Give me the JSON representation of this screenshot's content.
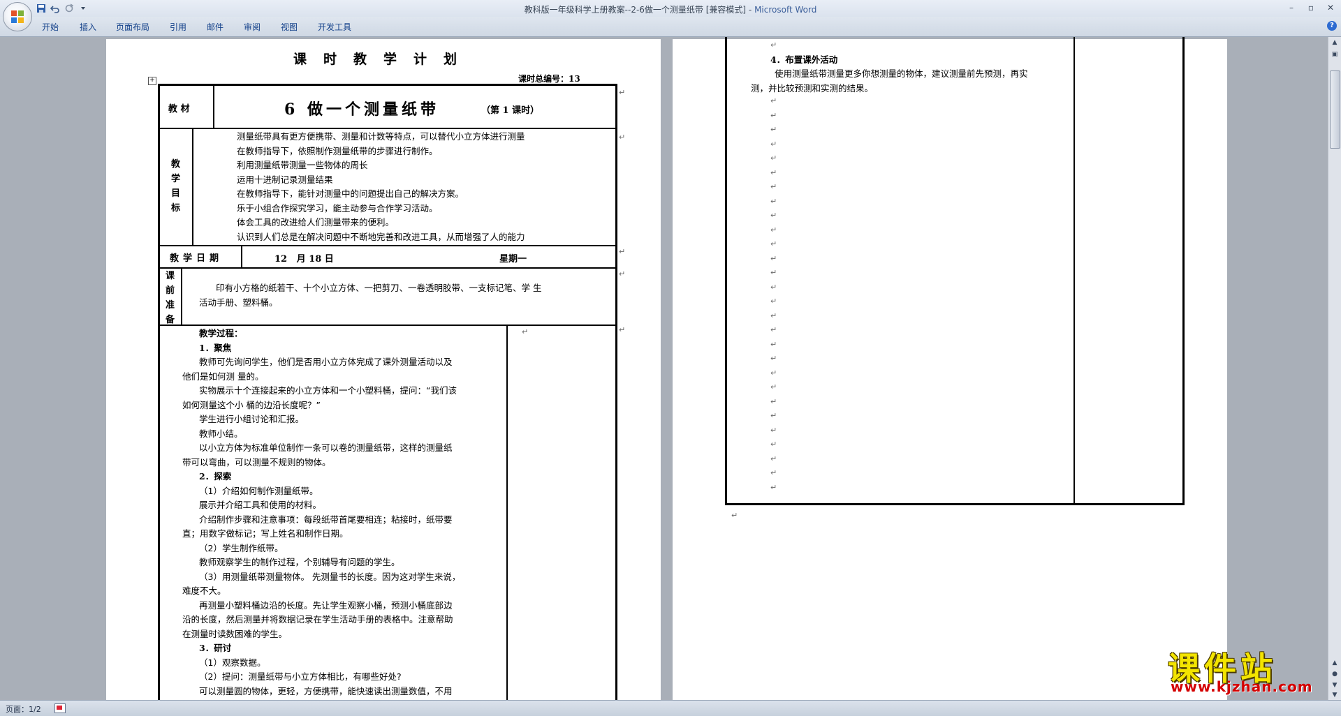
{
  "window": {
    "title": "教科版一年级科学上册教案--2-6做一个测量纸带 [兼容模式] - ",
    "app_name": "Microsoft Word",
    "controls": [
      "–",
      "▫",
      "✕"
    ]
  },
  "quick_access": [
    "save-icon",
    "undo-icon",
    "redo-icon",
    "customize-icon"
  ],
  "ribbon_tabs": [
    "开始",
    "插入",
    "页面布局",
    "引用",
    "邮件",
    "审阅",
    "视图",
    "开发工具"
  ],
  "page1": {
    "title": "课时教学计划",
    "lesson_number_label": "课时总编号：",
    "lesson_number": "13",
    "material_label": "教  材",
    "material_title": "6  做一个测量纸带",
    "material_note": "（第 1 课时）",
    "goals_label": [
      "教",
      "学",
      "目",
      "标"
    ],
    "goals": [
      "测量纸带具有更方便携带、测量和计数等特点，可以替代小立方体进行测量",
      "在教师指导下，依照制作测量纸带的步骤进行制作。",
      " 利用测量纸带测量一些物体的周长",
      "运用十进制记录测量结果",
      " 在教师指导下，能针对测量中的问题提出自己的解决方案。",
      "乐于小组合作探究学习，能主动参与合作学习活动。",
      "体会工具的改进给人们测量带来的便利。",
      "认识到人们总是在解决问题中不断地完善和改进工具，从而增强了人的能力"
    ],
    "date_label": "教学日期",
    "date_value": "12   月 18 日",
    "weekday": "星期一",
    "prep_label": [
      "课",
      "前",
      "准",
      "备"
    ],
    "prep_text": [
      "印有小方格的纸若干、十个小立方体、一把剪刀、一卷透明胶带、一支标记笔、学 生",
      "活动手册、塑料桶。"
    ],
    "process": [
      {
        "text": "教学过程：",
        "bold": true,
        "indent": 1
      },
      {
        "text": "1．聚焦",
        "bold": true,
        "indent": 1
      },
      {
        "text": "教师可先询问学生，他们是否用小立方体完成了课外测量活动以及",
        "indent": 1
      },
      {
        "text": "他们是如何测 量的。",
        "indent": 0
      },
      {
        "text": "实物展示十个连接起来的小立方体和一个小塑料桶，提问：“我们该",
        "indent": 1
      },
      {
        "text": "如何测量这个小 桶的边沿长度呢？”",
        "indent": 0
      },
      {
        "text": "学生进行小组讨论和汇报。",
        "indent": 1
      },
      {
        "text": "教师小结。",
        "indent": 1
      },
      {
        "text": "以小立方体为标准单位制作一条可以卷的测量纸带，这样的测量纸",
        "indent": 1
      },
      {
        "text": "带可以弯曲，可以测量不规则的物体。",
        "indent": 0
      },
      {
        "text": "2．探索",
        "bold": true,
        "indent": 1
      },
      {
        "text": "（1）介绍如何制作测量纸带。",
        "indent": 1
      },
      {
        "text": " 展示并介绍工具和使用的材料。",
        "indent": 1
      },
      {
        "text": "介绍制作步骤和注意事项：每段纸带首尾要相连；粘接时，纸带要",
        "indent": 1
      },
      {
        "text": "直；用数字做标记；写上姓名和制作日期。",
        "indent": 0
      },
      {
        "text": " （2）学生制作纸带。",
        "indent": 1
      },
      {
        "text": "教师观察学生的制作过程，个别辅导有问题的学生。",
        "indent": 1
      },
      {
        "text": "  （3）用测量纸带测量物体。 先测量书的长度。因为这对学生来说，",
        "indent": 1
      },
      {
        "text": "难度不大。",
        "indent": 0
      },
      {
        "text": "再测量小塑料桶边沿的长度。先让学生观察小桶，预测小桶底部边",
        "indent": 1
      },
      {
        "text": "沿的长度，然后测量并将数据记录在学生活动手册的表格中。注意帮助",
        "indent": 0
      },
      {
        "text": "在测量时读数困难的学生。",
        "indent": 0
      },
      {
        "text": "3．研讨",
        "bold": true,
        "indent": 1
      },
      {
        "text": "（1）观察数据。",
        "indent": 1
      },
      {
        "text": "（2）提问：测量纸带与小立方体相比，有哪些好处?",
        "indent": 1
      },
      {
        "text": "可以测量圆的物体，更轻，方便携带，能快速读出测量数值，不用",
        "indent": 1
      }
    ]
  },
  "page2": {
    "activity_title": "4．布置课外活动",
    "activity_lines": [
      "使用测量纸带测量更多你想测量的物体，建议测量前先预测，再实",
      "测，并比较预测和实测的结果。"
    ],
    "empty_paragraphs": 28
  },
  "status": {
    "page": "页面：1/2"
  },
  "watermark": {
    "main": "课件站",
    "url": "www.kjzhan.com"
  },
  "colors": {
    "background": "#a9afb8",
    "ribbon_text": "#15428b",
    "title_app": "#3c5f9a",
    "watermark_main": "#f3e400",
    "watermark_url": "#d40000"
  }
}
